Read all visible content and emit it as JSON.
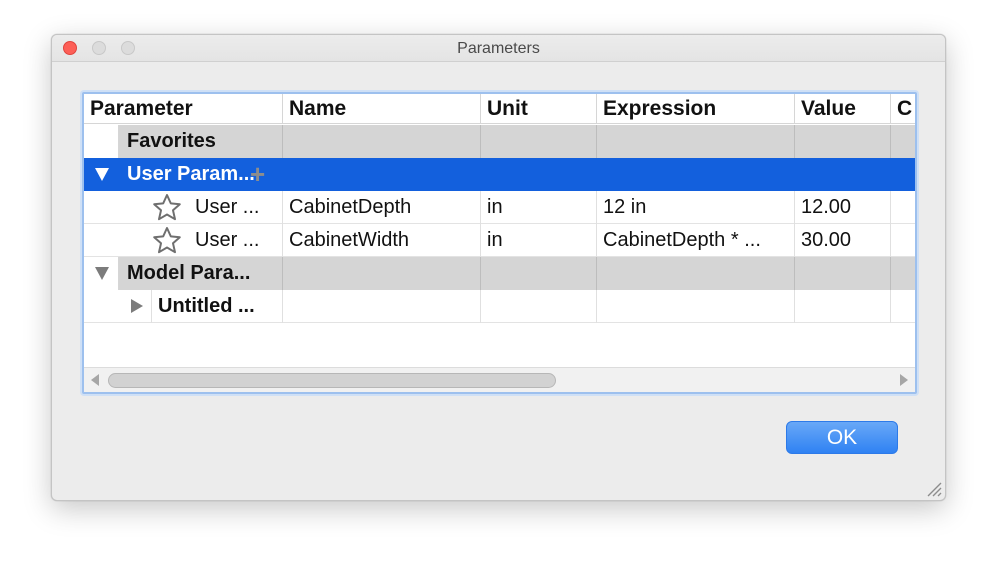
{
  "window": {
    "title": "Parameters"
  },
  "table": {
    "columns": [
      "Parameter",
      "Name",
      "Unit",
      "Expression",
      "Value",
      "C"
    ],
    "rows": [
      {
        "parameter": "Favorites",
        "name": "",
        "unit": "",
        "expression": "",
        "value": ""
      },
      {
        "parameter": "User Param...",
        "name": "",
        "unit": "",
        "expression": "",
        "value": ""
      },
      {
        "parameter": "User ...",
        "name": "CabinetDepth",
        "unit": "in",
        "expression": "12 in",
        "value": "12.00"
      },
      {
        "parameter": "User ...",
        "name": "CabinetWidth",
        "unit": "in",
        "expression": "CabinetDepth * ...",
        "value": "30.00"
      },
      {
        "parameter": "Model Para...",
        "name": "",
        "unit": "",
        "expression": "",
        "value": ""
      },
      {
        "parameter": "Untitled ...",
        "name": "",
        "unit": "",
        "expression": "",
        "value": ""
      }
    ]
  },
  "buttons": {
    "ok": "OK"
  },
  "colors": {
    "selection": "#1360dd",
    "accent_button": "#2f82f3",
    "close": "#fd5f57"
  },
  "icons": [
    "close-icon",
    "minimize-icon",
    "zoom-icon",
    "disclosure-triangle-icon",
    "add-icon",
    "star-icon",
    "resize-grip-icon"
  ]
}
